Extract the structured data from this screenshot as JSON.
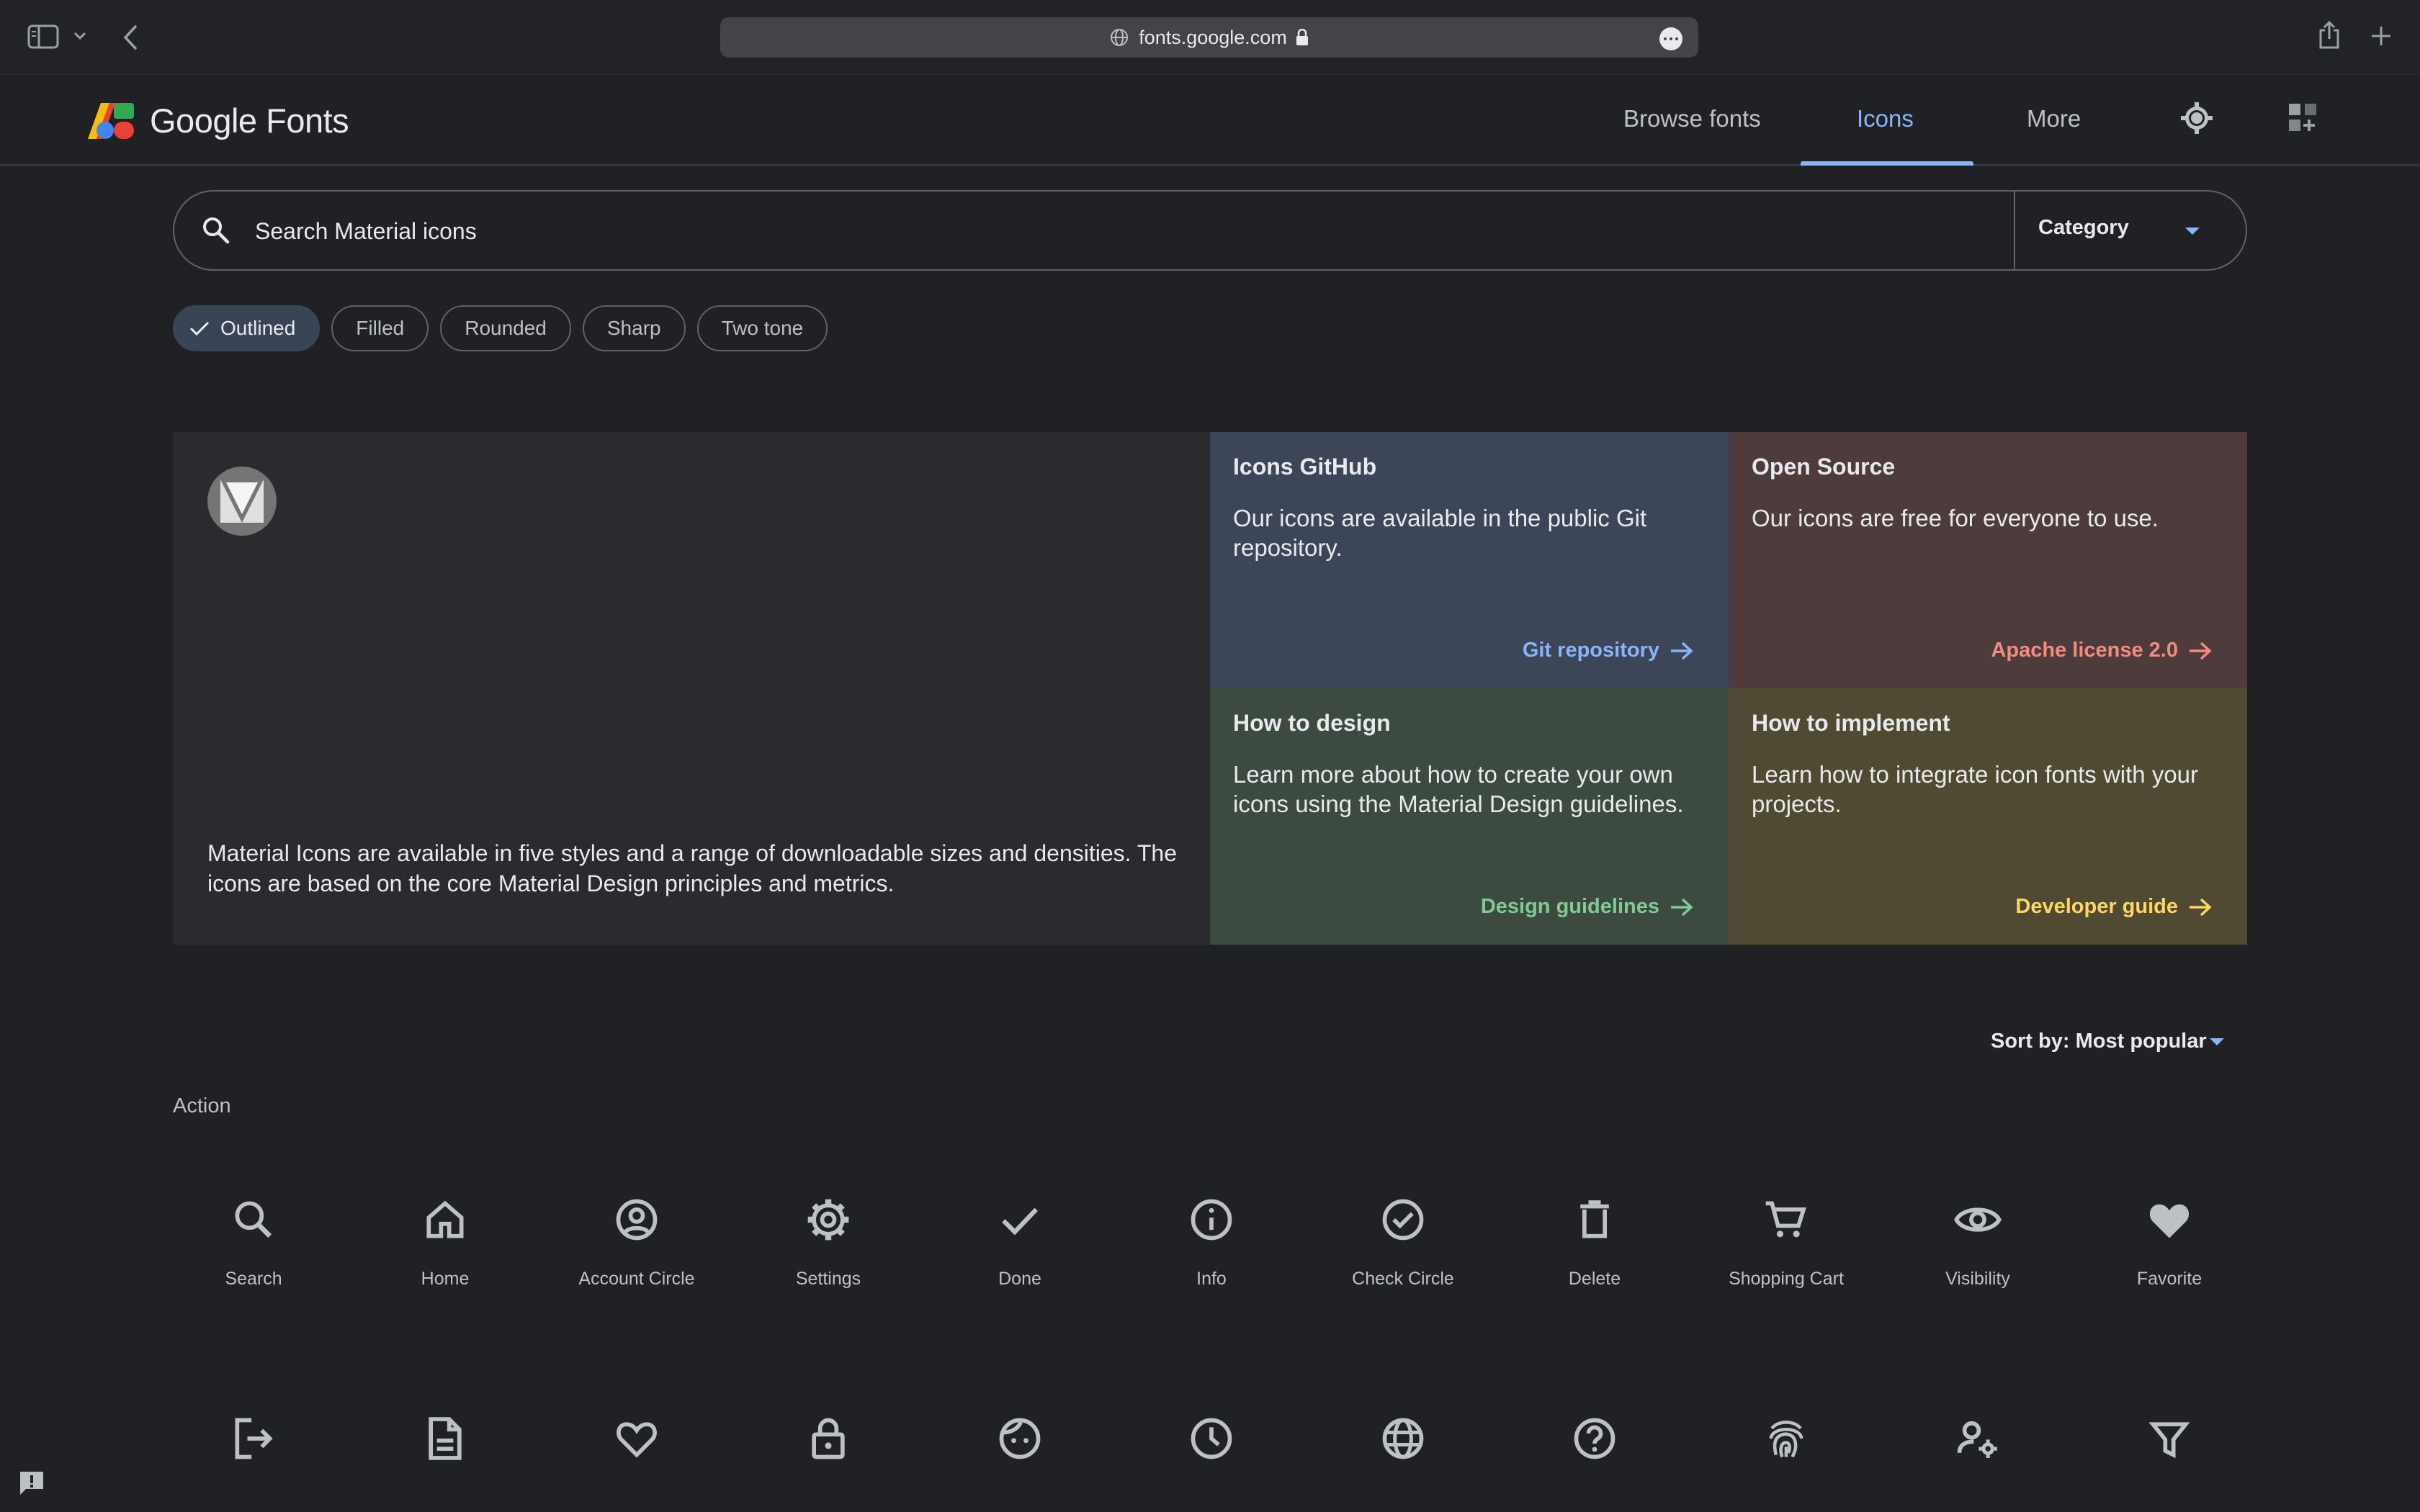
{
  "browser": {
    "url": "fonts.google.com"
  },
  "header": {
    "logo_text": "Google Fonts",
    "nav": {
      "browse_fonts": "Browse fonts",
      "icons": "Icons",
      "more": "More"
    }
  },
  "search": {
    "placeholder": "Search Material icons",
    "category_label": "Category"
  },
  "styles": {
    "outlined": "Outlined",
    "filled": "Filled",
    "rounded": "Rounded",
    "sharp": "Sharp",
    "two_tone": "Two tone",
    "selected": "Outlined"
  },
  "hero": {
    "description": "Material Icons are available in five styles and a range of downloadable sizes and densities. The icons are based on the core Material Design principles and metrics."
  },
  "cards": {
    "github": {
      "title": "Icons GitHub",
      "body": "Our icons are available in the public Git repository.",
      "link": "Git repository",
      "color": "#3c4658",
      "link_color": "#8ab4f8"
    },
    "open_source": {
      "title": "Open Source",
      "body": "Our icons are free for everyone to use.",
      "link": "Apache license 2.0",
      "color": "#4e3b3b",
      "link_color": "#f28b82"
    },
    "design": {
      "title": "How to design",
      "body": "Learn more about how to create your own icons using the Material Design guidelines.",
      "link": "Design guidelines",
      "color": "#3d4a40",
      "link_color": "#81c995"
    },
    "implement": {
      "title": "How to implement",
      "body": "Learn how to integrate icon fonts with your projects.",
      "link": "Developer guide",
      "color": "#504a33",
      "link_color": "#fdd663"
    }
  },
  "sort": {
    "label": "Sort by: Most popular"
  },
  "section": {
    "title": "Action"
  },
  "icons_row1": [
    {
      "name": "search-icon",
      "label": "Search"
    },
    {
      "name": "home-icon",
      "label": "Home"
    },
    {
      "name": "account-circle-icon",
      "label": "Account Circle"
    },
    {
      "name": "settings-icon",
      "label": "Settings"
    },
    {
      "name": "done-icon",
      "label": "Done"
    },
    {
      "name": "info-icon",
      "label": "Info"
    },
    {
      "name": "check-circle-icon",
      "label": "Check Circle"
    },
    {
      "name": "delete-icon",
      "label": "Delete"
    },
    {
      "name": "shopping-cart-icon",
      "label": "Shopping Cart"
    },
    {
      "name": "visibility-icon",
      "label": "Visibility"
    },
    {
      "name": "favorite-icon",
      "label": "Favorite"
    }
  ],
  "icons_row2": [
    {
      "name": "logout-icon"
    },
    {
      "name": "description-icon"
    },
    {
      "name": "favorite-border-icon"
    },
    {
      "name": "lock-icon"
    },
    {
      "name": "face-icon"
    },
    {
      "name": "schedule-icon"
    },
    {
      "name": "language-icon"
    },
    {
      "name": "help-outline-icon"
    },
    {
      "name": "fingerprint-icon"
    },
    {
      "name": "manage-accounts-icon"
    },
    {
      "name": "filter-alt-icon"
    }
  ]
}
